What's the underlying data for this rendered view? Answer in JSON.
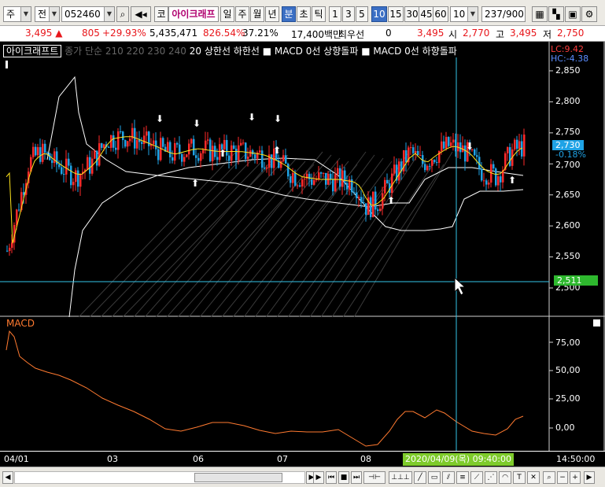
{
  "toolbar": {
    "market_select": "주",
    "type_select": "전",
    "code": "052460",
    "code_dropdown_icon": "chevron-down-icon",
    "search_icon": "search-icon",
    "sound_icon": "speaker-icon",
    "market_badge": "코",
    "stock_name": "아이크래프",
    "periods": [
      "일",
      "주",
      "월",
      "년",
      "분",
      "초",
      "틱"
    ],
    "active_period": "분",
    "intervals": [
      "1",
      "3",
      "5",
      "10",
      "15",
      "30",
      "45",
      "60"
    ],
    "active_interval": "10",
    "interval_select": "10",
    "count_display": "237",
    "count_total": "/900",
    "right_icons": [
      "grid-icon",
      "pattern-icon",
      "save-icon",
      "settings-icon"
    ]
  },
  "quote": {
    "price": "3,495",
    "change": "805",
    "change_pct": "+29.93%",
    "volume": "5,435,471",
    "volume_ratio": "826.54%",
    "turnover_ratio": "37.21%",
    "amount": "17,400백만",
    "preferred_label": "최우선",
    "preferred_value": "0",
    "last": "3,495",
    "open_label": "시",
    "open": "2,770",
    "high_label": "고",
    "high": "3,495",
    "low_label": "저",
    "low": "2,750"
  },
  "chart": {
    "name": "아이크래프트",
    "legend_dim": "종가 단순 210 220 230 240",
    "legend_items": [
      "20",
      "상한선",
      "하한선",
      "■ MACD 0선 상향돌파",
      "■ MACD 0선 하향돌파"
    ],
    "lc": "LC:9.42",
    "hc": "HC:-4.38",
    "current_price": "2,730",
    "current_pct": "-0.18%",
    "crosshair_price": "2,511",
    "price_axis": [
      "2,850",
      "2,800",
      "2,750",
      "2,700",
      "2,650",
      "2,600",
      "2,550",
      "2,500"
    ],
    "macd_title": "MACD",
    "macd_axis": [
      "75,00",
      "50,00",
      "25,00",
      "0,00"
    ],
    "x_labels": [
      "04/01",
      "03",
      "06",
      "07",
      "08"
    ],
    "crosshair_date": "2020/04/09(목) 09:40:00",
    "time_label": "14:50:00",
    "colors": {
      "up": "#ff2a2a",
      "down": "#1fa3e6",
      "ma": "#ffe41c",
      "band": "#ffffff",
      "macd": "#ff7a30",
      "crosshair": "#34c4e8",
      "tag": "#2eb82e"
    }
  },
  "bottom": {
    "nav_buttons": [
      "▶",
      "⏮",
      "■",
      "⏭",
      "⊣⊢"
    ],
    "zoom_out": "−",
    "zoom_in": "+",
    "search": "search-icon"
  }
}
